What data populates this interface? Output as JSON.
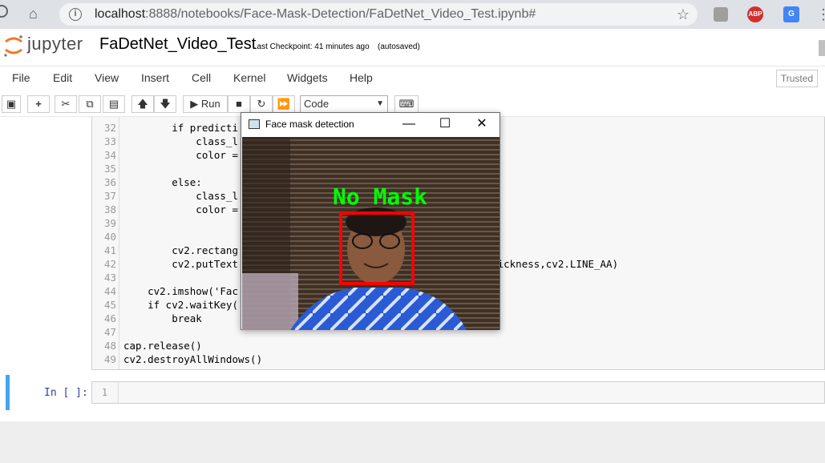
{
  "browser": {
    "url_host": "localhost",
    "url_path": ":8888/notebooks/Face-Mask-Detection/FaDetNet_Video_Test.ipynb#",
    "ext_abp": "ABP",
    "ext_translate": "G"
  },
  "header": {
    "logo_text": "jupyter",
    "notebook_name": "FaDetNet_Video_Test",
    "checkpoint": "Last Checkpoint: 41 minutes ago",
    "autosaved": "(autosaved)"
  },
  "menu": {
    "items": [
      "File",
      "Edit",
      "View",
      "Insert",
      "Cell",
      "Kernel",
      "Widgets",
      "Help"
    ],
    "trusted": "Trusted"
  },
  "toolbar": {
    "run_label": "Run",
    "cell_type": "Code"
  },
  "code_cell": {
    "line_numbers": [
      "32",
      "33",
      "34",
      "35",
      "36",
      "37",
      "38",
      "39",
      "40",
      "41",
      "42",
      "43",
      "44",
      "45",
      "46",
      "47",
      "48",
      "49"
    ],
    "lines": [
      "        if predicti",
      "            class_l",
      "            color =",
      "",
      "        else:",
      "            class_l",
      "            color =",
      "",
      "",
      "        cv2.rectang",
      "        cv2.putText                             ale, color, thickness,cv2.LINE_AA)",
      "",
      "    cv2.imshow('Fac",
      "    if cv2.waitKey(",
      "        break",
      "",
      "cap.release()",
      "cv2.destroyAllWindows()"
    ]
  },
  "empty_cell": {
    "prompt": "In [ ]:",
    "line_number": "1"
  },
  "window": {
    "title": "Face mask detection",
    "label": "No Mask",
    "label_color": "#00ff00",
    "box_color": "#ff0000"
  }
}
